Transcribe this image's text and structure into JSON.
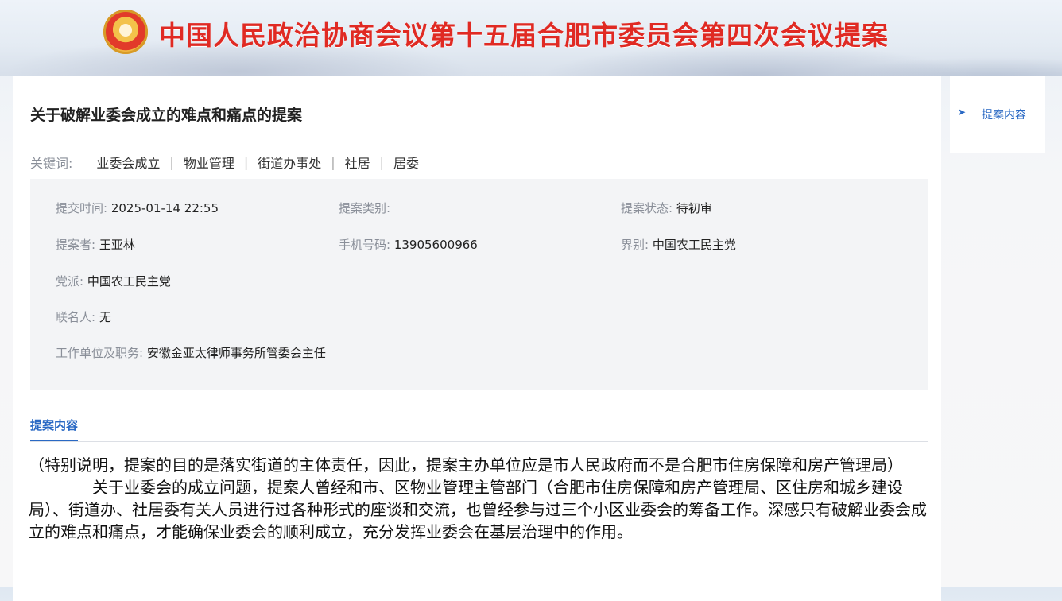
{
  "banner": {
    "title": "中国人民政治协商会议第十五届合肥市委员会第四次会议提案"
  },
  "proposal": {
    "title": "关于破解业委会成立的难点和痛点的提案",
    "keywords_label": "关键词:",
    "keywords": [
      "业委会成立",
      "物业管理",
      "街道办事处",
      "社居",
      "居委"
    ],
    "separator": "|",
    "info": {
      "submit_time_label": "提交时间:",
      "submit_time": "2025-01-14 22:55",
      "category_label": "提案类别:",
      "category": "",
      "status_label": "提案状态:",
      "status": "待初审",
      "proposer_label": "提案者:",
      "proposer": "王亚林",
      "phone_label": "手机号码:",
      "phone": "13905600966",
      "sector_label": "界别:",
      "sector": "中国农工民主党",
      "party_label": "党派:",
      "party": "中国农工民主党",
      "cosigners_label": "联名人:",
      "cosigners": "无",
      "work_label": "工作单位及职务:",
      "work": "安徽金亚太律师事务所管委会主任"
    },
    "content_heading": "提案内容",
    "content": [
      "（特别说明，提案的目的是落实街道的主体责任，因此，提案主办单位应是市人民政府而不是合肥市住房保障和房产管理局）",
      "关于业委会的成立问题，提案人曾经和市、区物业管理主管部门（合肥市住房保障和房产管理局、区住房和城乡建设局）、街道办、社居委有关人员进行过各种形式的座谈和交流，也曾经参与过三个小区业委会的筹备工作。深感只有破解业委会成立的难点和痛点，才能确保业委会的顺利成立，充分发挥业委会在基层治理中的作用。"
    ]
  },
  "sidebar": {
    "arrow": "➤",
    "link_label": "提案内容"
  },
  "colors": {
    "banner_title": "#e02a23",
    "accent": "#2a69c4",
    "info_bg": "#f3f4f6"
  }
}
